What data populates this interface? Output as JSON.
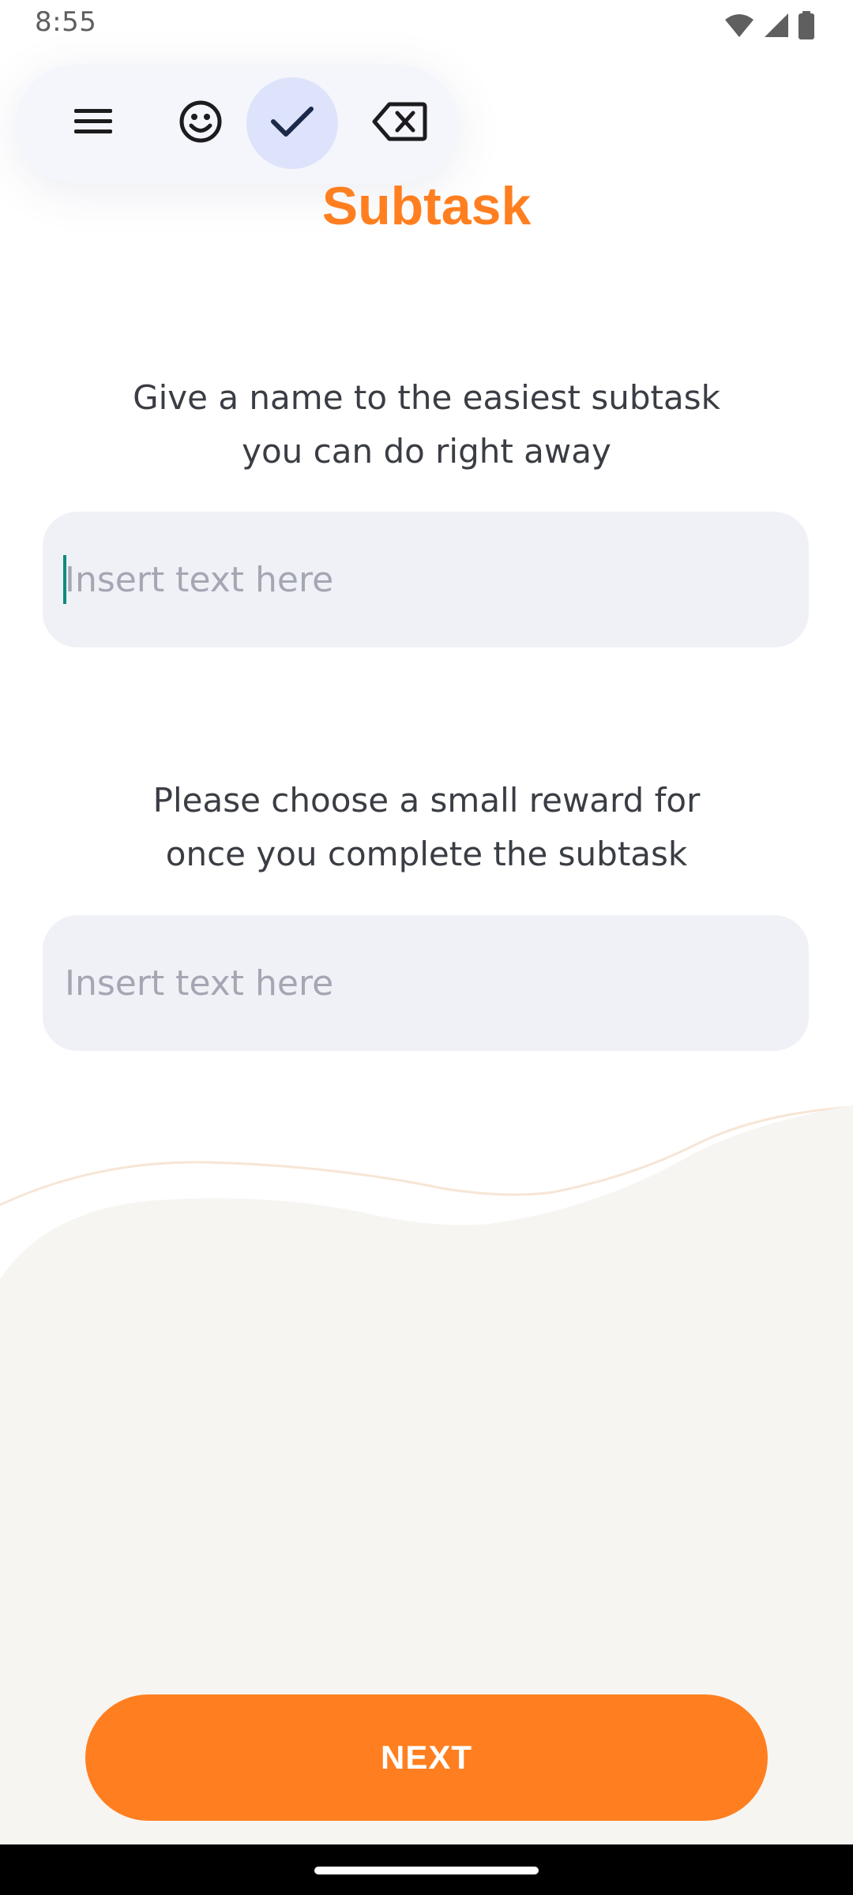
{
  "status_bar": {
    "time": "8:55",
    "icons": [
      "wifi-icon",
      "signal-icon",
      "battery-icon"
    ]
  },
  "toolbar": {
    "items": [
      {
        "icon": "menu-icon"
      },
      {
        "icon": "emoji-icon"
      },
      {
        "icon": "check-icon",
        "active": true
      },
      {
        "icon": "backspace-icon"
      }
    ]
  },
  "page": {
    "title": "Subtask"
  },
  "subtask_section": {
    "prompt_line1": "Give a name to the easiest subtask",
    "prompt_line2": "you can do right away",
    "input_value": "",
    "input_placeholder": "Insert text here"
  },
  "reward_section": {
    "prompt_line1": "Please choose a small reward for",
    "prompt_line2": "once you complete the subtask",
    "input_value": "",
    "input_placeholder": "Insert text here"
  },
  "actions": {
    "next_label": "NEXT"
  },
  "colors": {
    "accent": "#ff7f20",
    "field_bg": "#f0f1f6",
    "wave_bg": "#f7f5f2",
    "toolbar_active": "#dde3fb"
  }
}
